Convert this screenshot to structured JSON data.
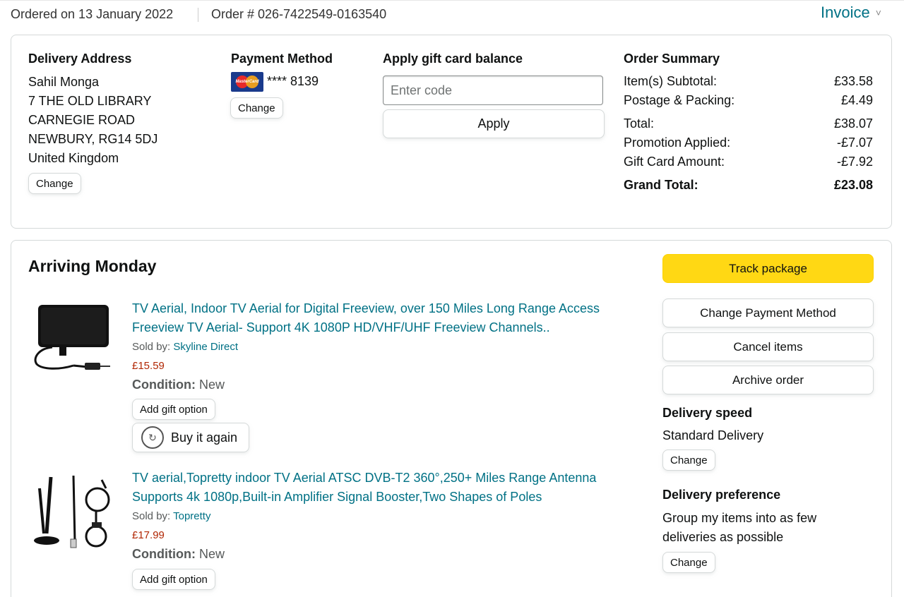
{
  "header": {
    "ordered_on": "Ordered on 13 January 2022",
    "order_number": "Order # 026-7422549-0163540",
    "invoice_label": "Invoice",
    "invoice_chevron": "˅"
  },
  "delivery_address": {
    "heading": "Delivery Address",
    "lines": [
      "Sahil Monga",
      "7 THE OLD LIBRARY",
      "CARNEGIE ROAD",
      "NEWBURY, RG14 5DJ",
      "United Kingdom"
    ],
    "change_label": "Change"
  },
  "payment_method": {
    "heading": "Payment Method",
    "card_brand": "MasterCard",
    "card_text": "**** 8139",
    "change_label": "Change"
  },
  "gift_card": {
    "heading": "Apply gift card balance",
    "placeholder": "Enter code",
    "apply_label": "Apply"
  },
  "order_summary": {
    "heading": "Order Summary",
    "rows": [
      {
        "label": "Item(s) Subtotal:",
        "value": "£33.58"
      },
      {
        "label": "Postage & Packing:",
        "value": "£4.49"
      },
      {
        "label": "Total:",
        "value": "£38.07"
      },
      {
        "label": "Promotion Applied:",
        "value": "-£7.07"
      },
      {
        "label": "Gift Card Amount:",
        "value": "-£7.92"
      }
    ],
    "grand_total": {
      "label": "Grand Total:",
      "value": "£23.08"
    }
  },
  "shipment": {
    "heading": "Arriving Monday",
    "items": [
      {
        "title": "TV Aerial, Indoor TV Aerial for Digital Freeview, over 150 Miles Long Range Access Freeview TV Aerial- Support 4K 1080P HD/VHF/UHF Freeview Channels..",
        "sold_by_label": "Sold by:",
        "seller": "Skyline Direct",
        "price": "£15.59",
        "condition_label": "Condition:",
        "condition": "New",
        "gift_label": "Add gift option",
        "buy_again_label": "Buy it again"
      },
      {
        "title": "TV aerial,Topretty indoor TV Aerial ATSC DVB-T2 360°,250+ Miles Range Antenna Supports 4k 1080p,Built-in Amplifier Signal Booster,Two Shapes of Poles",
        "sold_by_label": "Sold by:",
        "seller": "Topretty",
        "price": "£17.99",
        "condition_label": "Condition:",
        "condition": "New",
        "gift_label": "Add gift option"
      }
    ]
  },
  "actions": {
    "track": "Track package",
    "change_payment": "Change Payment Method",
    "cancel": "Cancel items",
    "archive": "Archive order"
  },
  "delivery_speed": {
    "heading": "Delivery speed",
    "value": "Standard Delivery",
    "change_label": "Change"
  },
  "delivery_preference": {
    "heading": "Delivery preference",
    "value_line1": "Group my items into as few",
    "value_line2": "deliveries as possible",
    "change_label": "Change"
  },
  "colors": {
    "link": "#007185",
    "price": "#B12704",
    "track_button": "#FFD814"
  }
}
